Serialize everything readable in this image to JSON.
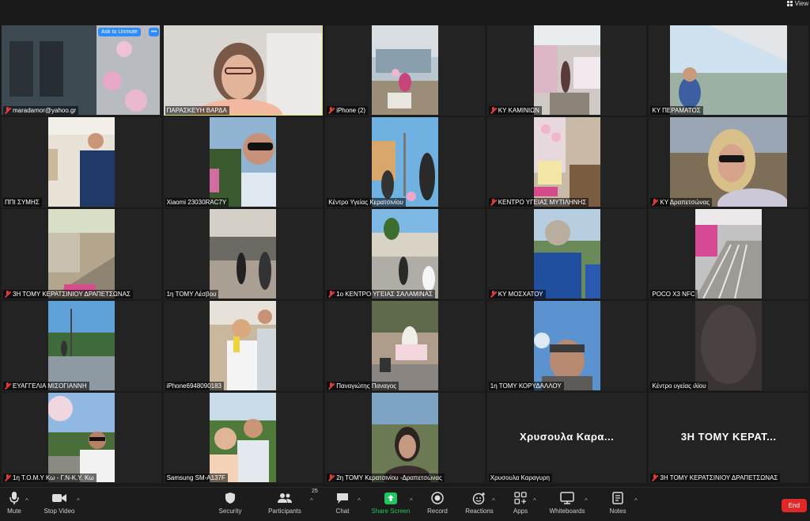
{
  "topbar": {
    "view_label": "View"
  },
  "tiles": [
    {
      "name": "maradamor@yahoo.gr",
      "muted": true,
      "unmute": "Ask to Unmute",
      "more": "•••"
    },
    {
      "name": "ΠΑΡΑΣΚΕΥΗ ΒΑΡΔΑ",
      "muted": false,
      "active": true
    },
    {
      "name": "iPhone (2)",
      "muted": true
    },
    {
      "name": "ΚΥ ΚΑΜΙΝΙΩΝ",
      "muted": true
    },
    {
      "name": "ΚΥ ΠΕΡΑΜΑΤΟΣ",
      "muted": false
    },
    {
      "name": "ΠΠΙ ΣΥΜΗΣ",
      "muted": false
    },
    {
      "name": "Xiaomi 23030RAC7Y",
      "muted": false
    },
    {
      "name": "Κέντρο Υγείας Κερατσινίου",
      "muted": false
    },
    {
      "name": "ΚΕΝΤΡΟ ΥΓΕΙΑΣ ΜΥΤΙΛΗΝΗΣ",
      "muted": true
    },
    {
      "name": "ΚΥ Δραπετσώνας",
      "muted": true
    },
    {
      "name": "3Η ΤΟΜΥ ΚΕΡΑΤΣΙΝΙΟΥ ΔΡΑΠΕΤΣΩΝΑΣ",
      "muted": true
    },
    {
      "name": "1η ΤΟΜΥ Λέσβου",
      "muted": false
    },
    {
      "name": "1ο ΚΕΝΤΡΟ ΥΓΕΙΑΣ ΣΑΛΑΜΙΝΑΣ",
      "muted": true
    },
    {
      "name": "ΚΥ ΜΟΣΧΑΤΟΥ",
      "muted": true
    },
    {
      "name": "POCO X3 NFC",
      "muted": false
    },
    {
      "name": "ΕΥΑΓΓΕΛΙΑ ΜΙΣΟΓΙΑΝΝΗ",
      "muted": true
    },
    {
      "name": "iPhone6948090183",
      "muted": false
    },
    {
      "name": "Παναγιώτης Παναγος",
      "muted": true
    },
    {
      "name": "1η ΤΟΜΥ ΚΟΡΥΔΑΛΛΟΥ",
      "muted": false
    },
    {
      "name": "Κέντρο υγείας ιλίου",
      "muted": false
    },
    {
      "name": "1η Τ.Ο.Μ.Υ Κω - Γ.Ν-Κ.Υ. Κω",
      "muted": true
    },
    {
      "name": "Samsung SM-A137F",
      "muted": false
    },
    {
      "name": "2η ΤΟΜΥ Κερατσινίου -Δραπετσώνας",
      "muted": true
    },
    {
      "name": "Χρυσουλα Καραγυρη",
      "muted": false,
      "big": "Χρυσουλα Καρα..."
    },
    {
      "name": "3Η ΤΟΜΥ ΚΕΡΑΤΣΙΝΙΟΥ ΔΡΑΠΕΤΣΩΝΑΣ",
      "muted": true,
      "big": "3Η ΤΟΜΥ ΚΕΡΑΤ..."
    }
  ],
  "toolbar": {
    "mute": "Mute",
    "stop_video": "Stop Video",
    "security": "Security",
    "participants": "Participants",
    "participants_count": "25",
    "chat": "Chat",
    "share_screen": "Share Screen",
    "record": "Record",
    "reactions": "Reactions",
    "apps": "Apps",
    "whiteboards": "Whiteboards",
    "notes": "Notes",
    "end": "End"
  },
  "colors": {
    "active_speaker": "#d8e06a",
    "share_green": "#22c55e",
    "end_red": "#e02828",
    "unmute_blue": "#2d8cff",
    "muted_red": "#e23b3b"
  }
}
